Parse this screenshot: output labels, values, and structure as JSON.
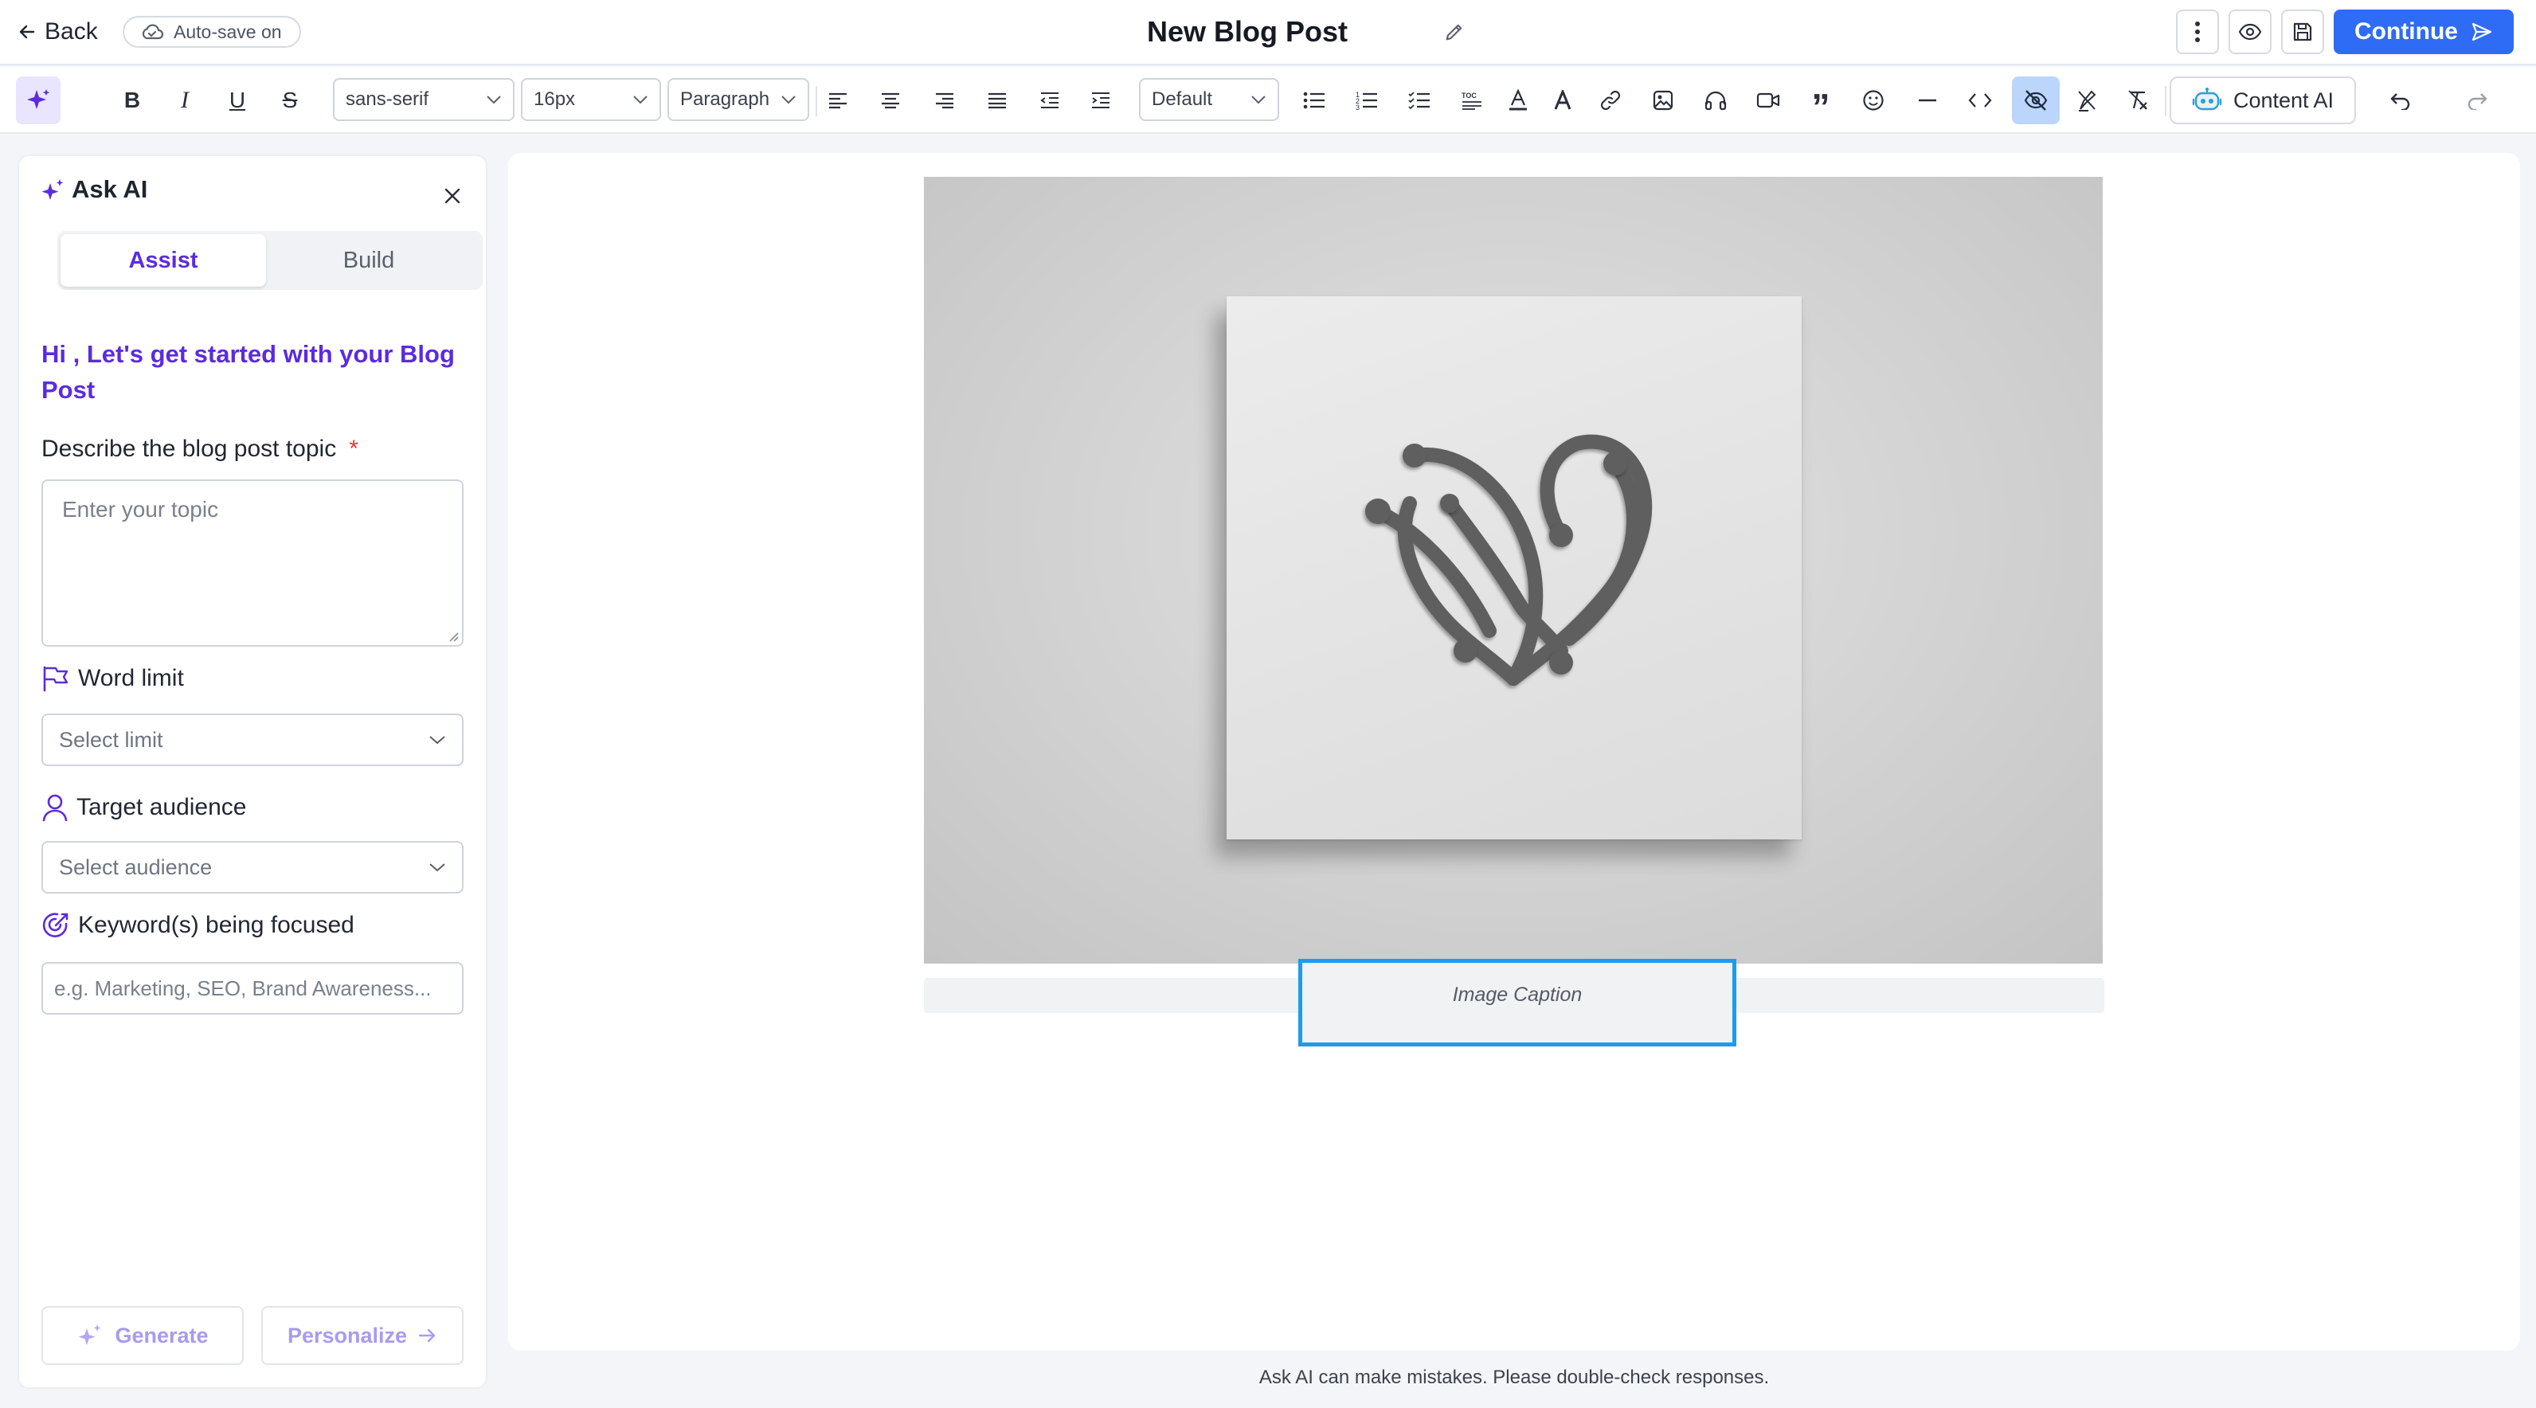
{
  "header": {
    "back_label": "Back",
    "autosave_label": "Auto-save on",
    "title": "New Blog Post",
    "continue_label": "Continue"
  },
  "toolbar": {
    "font_family": "sans-serif",
    "font_size": "16px",
    "block_type": "Paragraph",
    "style_preset": "Default",
    "content_ai_label": "Content AI"
  },
  "panel": {
    "title": "Ask AI",
    "tabs": [
      {
        "label": "Assist"
      },
      {
        "label": "Build"
      }
    ],
    "greeting": "Hi , Let's get started with your Blog Post",
    "topic": {
      "label": "Describe the blog post topic",
      "required_mark": "*",
      "placeholder": "Enter your topic"
    },
    "word_limit": {
      "label": "Word limit",
      "placeholder": "Select limit"
    },
    "audience": {
      "label": "Target audience",
      "placeholder": "Select audience"
    },
    "keywords": {
      "label": "Keyword(s) being focused",
      "placeholder": "e.g. Marketing, SEO, Brand Awareness..."
    },
    "generate_label": "Generate",
    "personalize_label": "Personalize"
  },
  "editor": {
    "caption_placeholder": "Image Caption"
  },
  "footer": {
    "disclaimer": "Ask AI can make mistakes. Please double-check responses."
  },
  "colors": {
    "accent": "#2f6cf5",
    "ai_purple": "#5b2be0",
    "caption_focus": "#1b9cf0",
    "active_tool": "#bcd6fb"
  }
}
